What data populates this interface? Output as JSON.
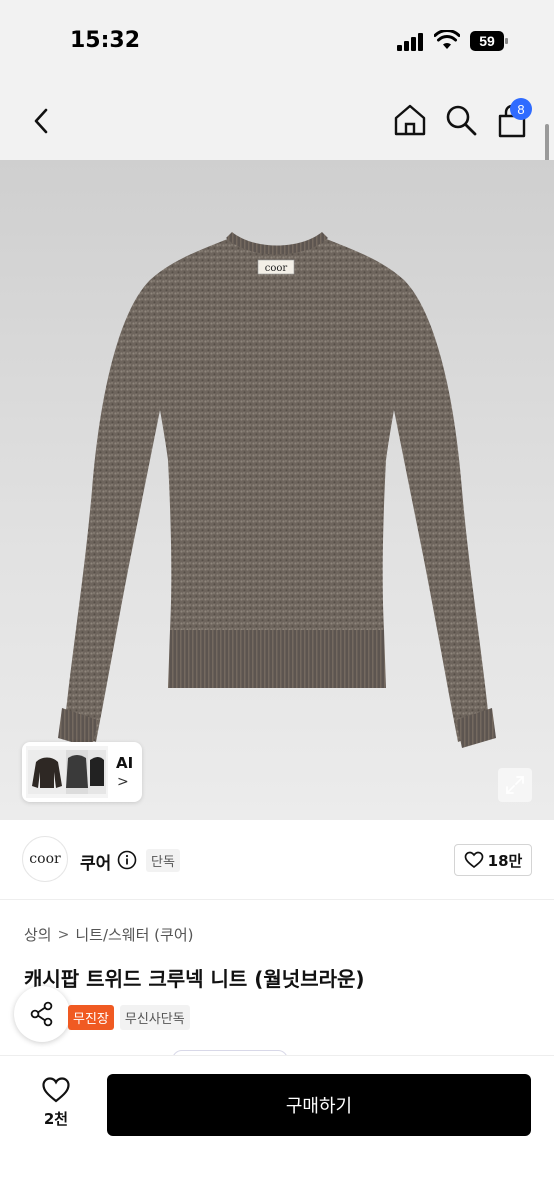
{
  "status_bar": {
    "time": "15:32",
    "battery": "59"
  },
  "nav": {
    "cart_badge": "8"
  },
  "product_image": {
    "ai_label": "AI",
    "ai_chevron": ">",
    "logo_text": "coor"
  },
  "brand": {
    "logo_text": "coor",
    "name": "쿠어",
    "tag": "단독",
    "like_count": "18만"
  },
  "breadcrumb": {
    "items": [
      "상의",
      "니트/스웨터 (쿠어)"
    ],
    "separator": ">"
  },
  "product": {
    "title": "캐시팝 트위드 크루넥 니트 (월넛브라운)"
  },
  "badges": {
    "orange": "무진장",
    "gray": "무신사단독"
  },
  "bottom_bar": {
    "wish_count": "2천",
    "buy_label": "구매하기"
  },
  "colors": {
    "accent_blue": "#2f6bff",
    "badge_orange": "#f05a22",
    "buy_button": "#000000"
  }
}
